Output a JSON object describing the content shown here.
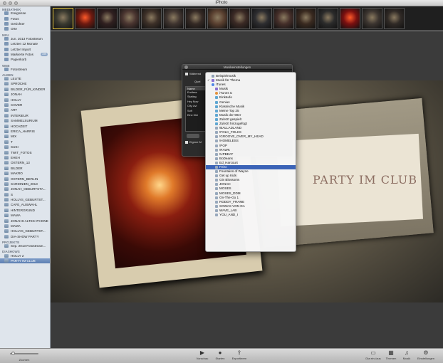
{
  "window": {
    "title": "iPhoto"
  },
  "sidebar": {
    "sections": [
      {
        "header": "MEDIATHEK",
        "items": [
          {
            "label": "Ereignisse",
            "icon": "events-icon"
          },
          {
            "label": "Fotos",
            "icon": "photos-icon"
          },
          {
            "label": "Gesichter",
            "icon": "faces-icon"
          },
          {
            "label": "Orte",
            "icon": "places-icon"
          }
        ]
      },
      {
        "header": "NEU",
        "items": [
          {
            "label": "Jun. 2013 Fotostream",
            "icon": "event-icon"
          },
          {
            "label": "Letzten 12 Monate",
            "icon": "calendar-icon"
          },
          {
            "label": "Letzter Import",
            "icon": "import-icon"
          },
          {
            "label": "Markierte Fotos",
            "icon": "flag-icon",
            "badge": "199"
          },
          {
            "label": "Papierkorb",
            "icon": "trash-icon"
          }
        ]
      },
      {
        "header": "WEB",
        "items": [
          {
            "label": "Fotostream",
            "icon": "photostream-icon"
          }
        ]
      },
      {
        "header": "ALBEN",
        "items": [
          {
            "label": "LEUTE"
          },
          {
            "label": "SPRÜCHE"
          },
          {
            "label": "BILDER_FÜR_KINDER"
          },
          {
            "label": "JONAH"
          },
          {
            "label": "HOLLY"
          },
          {
            "label": "COVER"
          },
          {
            "label": "ART"
          },
          {
            "label": "INTERIEUR"
          },
          {
            "label": "SAMMELSURIUM"
          },
          {
            "label": "HOCHZEIT"
          },
          {
            "label": "ERICA_HARRIS"
          },
          {
            "label": "MIX"
          },
          {
            "label": "T"
          },
          {
            "label": "SUSI"
          },
          {
            "label": "TWIT_FOTOS"
          },
          {
            "label": "EHEH"
          },
          {
            "label": "OSTERN_13"
          },
          {
            "label": "BILDER"
          },
          {
            "label": "MAKRO"
          },
          {
            "label": "OSTERN_BERLIN"
          },
          {
            "label": "SARDINIEN_2013"
          },
          {
            "label": "JONAH_GEBURTSTA..."
          },
          {
            "label": "S"
          },
          {
            "label": "HOLLYS_GEBURTST..."
          },
          {
            "label": "CAFE_AUSWAHL"
          },
          {
            "label": "HINTERGRUND"
          },
          {
            "label": "MAMA"
          },
          {
            "label": "JONAHS ALTES IPHONE"
          },
          {
            "label": "MAMA"
          },
          {
            "label": "HOLLYS_GEBURTST..."
          },
          {
            "label": "DIA-SHOW PARTY"
          }
        ]
      },
      {
        "header": "PROJEKTE",
        "items": [
          {
            "label": "Sep. 2013 Fotostream..."
          }
        ]
      },
      {
        "header": "DIASHOWS",
        "items": [
          {
            "label": "HOLLY 2"
          },
          {
            "label": "PARTY IM CLUB",
            "selected": true
          }
        ]
      }
    ]
  },
  "slide": {
    "text": "PARTY IM CLUB"
  },
  "dialog": {
    "title": "Musikeinstellungen",
    "option_play": "Während",
    "source_label": "Quel",
    "list_header": "Name",
    "list_items": [
      "Endless",
      "Skating",
      "Hey Now",
      "City Livi",
      "Soft",
      "Eine Klei"
    ],
    "option_custom": "Eigene M"
  },
  "menu": {
    "items": [
      {
        "label": "Beispielmusik",
        "icon": "folder",
        "indent": false
      },
      {
        "label": "Musik für Thema",
        "icon": "music",
        "indent": false,
        "checked": true
      },
      {
        "label": "iTunes",
        "icon": "itunes",
        "indent": false
      },
      {
        "label": "Musik",
        "icon": "music",
        "indent": true
      },
      {
        "label": "iTunes U",
        "icon": "itunes-u",
        "indent": true
      },
      {
        "label": "Einkäufe",
        "icon": "purchases",
        "indent": true
      },
      {
        "label": "Genius",
        "icon": "genius",
        "indent": true
      },
      {
        "label": "Klassische Musik",
        "icon": "smart",
        "indent": true
      },
      {
        "label": "Meine Top 25",
        "icon": "smart",
        "indent": true
      },
      {
        "label": "Musik der 90er",
        "icon": "smart",
        "indent": true
      },
      {
        "label": "Zuletzt gespielt",
        "icon": "smart",
        "indent": true
      },
      {
        "label": "Zuletzt hinzugefügt",
        "icon": "smart",
        "indent": true
      },
      {
        "label": "!BALLADLAND",
        "icon": "playlist",
        "indent": true
      },
      {
        "label": "!FOLK_FOLKS",
        "icon": "playlist",
        "indent": true
      },
      {
        "label": "!GROOVE_OVER_MY_HEAD",
        "icon": "playlist",
        "indent": true
      },
      {
        "label": "!HOMELESS",
        "icon": "playlist",
        "indent": true
      },
      {
        "label": "!POP",
        "icon": "playlist",
        "indent": true
      },
      {
        "label": "!RAWK",
        "icon": "playlist",
        "indent": true
      },
      {
        "label": "!UPBEAT",
        "icon": "playlist",
        "indent": true
      },
      {
        "label": "BoDeans",
        "icon": "playlist",
        "indent": true
      },
      {
        "label": "Ed_Harcourt",
        "icon": "playlist",
        "indent": true
      },
      {
        "label": "Feist",
        "icon": "playlist",
        "indent": true,
        "highlight": true
      },
      {
        "label": "Fountains of Wayne",
        "icon": "playlist",
        "indent": true
      },
      {
        "label": "Get up Kids",
        "icon": "playlist",
        "indent": true
      },
      {
        "label": "Gin Blossoms",
        "icon": "playlist",
        "indent": true
      },
      {
        "label": "JONAH",
        "icon": "playlist",
        "indent": true
      },
      {
        "label": "MOSES",
        "icon": "playlist",
        "indent": true
      },
      {
        "label": "MOSES_DDM",
        "icon": "playlist",
        "indent": true
      },
      {
        "label": "On-The-Go 1",
        "icon": "playlist",
        "indent": true
      },
      {
        "label": "RODDY_FRAME",
        "icon": "playlist",
        "indent": true
      },
      {
        "label": "SOWAS VON DA",
        "icon": "playlist",
        "indent": true
      },
      {
        "label": "WAVE_LAB",
        "icon": "playlist",
        "indent": true
      },
      {
        "label": "YOU_AND_I",
        "icon": "playlist",
        "indent": true
      }
    ]
  },
  "toolbar": {
    "zoom_label": "Zoomen",
    "preview_label": "Vorschau",
    "play_label": "Starten",
    "export_label": "Exportieren",
    "slide_label": "Dia ein-/aus",
    "themes_label": "Themen",
    "music_label": "Musik",
    "settings_label": "Einstellungen"
  },
  "colors": {
    "selection": "#3b63b7",
    "sidebar_bg": "#dfe5ec"
  }
}
